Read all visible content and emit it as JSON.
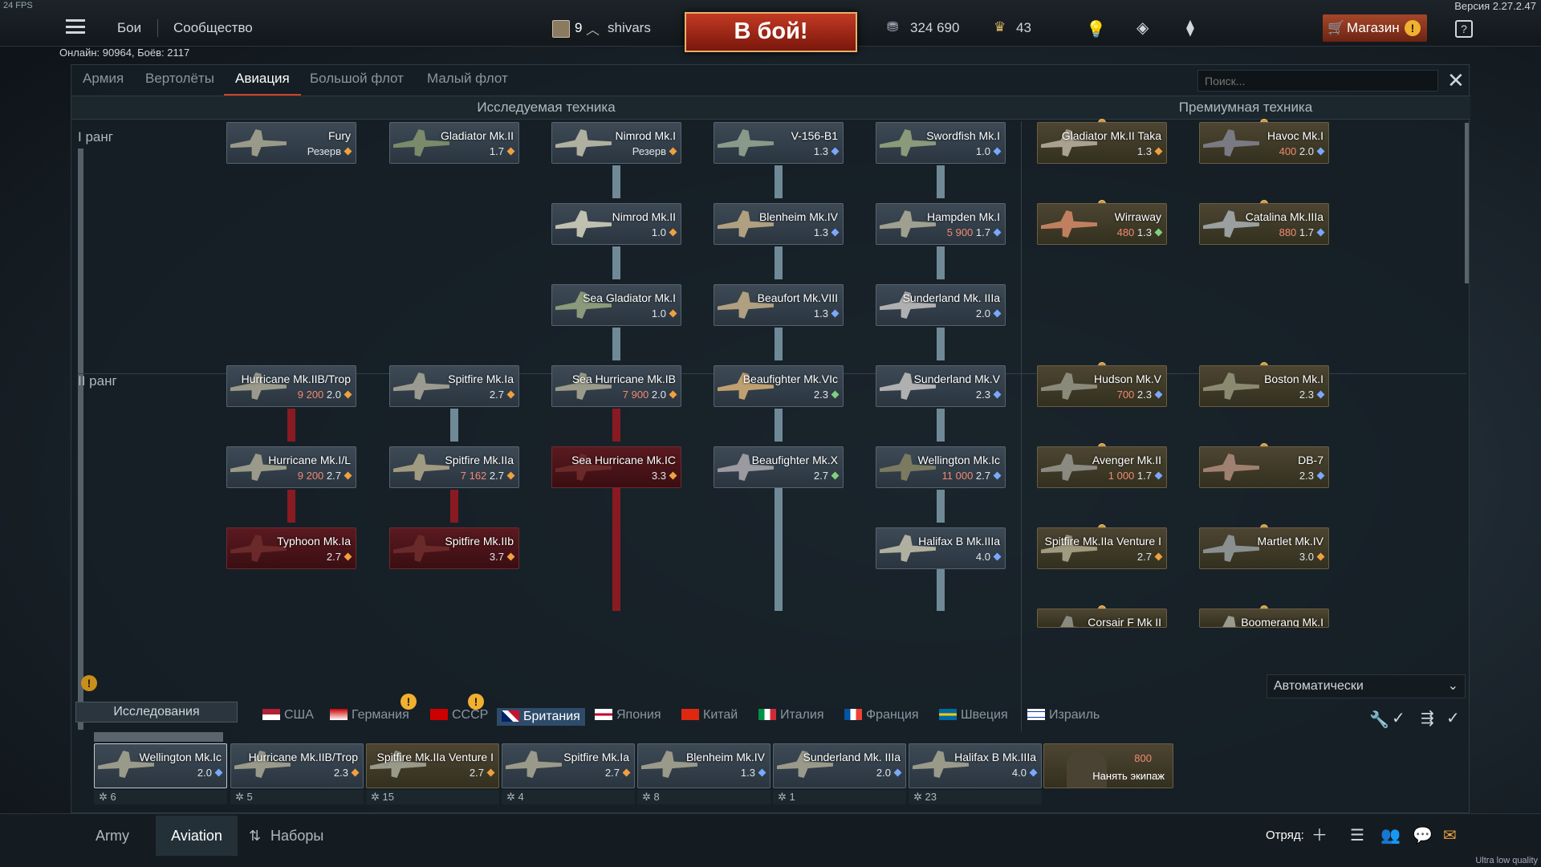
{
  "topbar": {
    "fps": "24 FPS",
    "version": "Версия 2.27.2.47",
    "menu_battles": "Бои",
    "menu_community": "Сообщество",
    "player_level": "9",
    "player_name": "shivars",
    "battle_button": "В бой!",
    "silver": "324 690",
    "gold": "43",
    "shop": "Магазин",
    "online": "Онлайн: 90964, Боёв: 2117"
  },
  "tabs": [
    "Армия",
    "Вертолёты",
    "Авиация",
    "Большой флот",
    "Малый флот"
  ],
  "active_tab": "Авиация",
  "search_placeholder": "Поиск...",
  "headers": {
    "research": "Исследуемая техника",
    "premium": "Премиумная техника"
  },
  "ranks": [
    "I ранг",
    "II ранг"
  ],
  "cards": [
    {
      "name": "Fury",
      "br": "Резерв",
      "diamond": "orange"
    },
    {
      "name": "Gladiator Mk.II",
      "br": "1.7",
      "diamond": "orange"
    },
    {
      "name": "Nimrod Mk.I",
      "br": "Резерв",
      "diamond": "orange"
    },
    {
      "name": "V-156-B1",
      "br": "1.3",
      "diamond": "blue"
    },
    {
      "name": "Swordfish Mk.I",
      "br": "1.0",
      "diamond": "blue"
    },
    {
      "name": "Gladiator Mk.II Taka",
      "br": "1.3",
      "diamond": "orange"
    },
    {
      "name": "Havoc Mk.I",
      "cost": "400",
      "br": "2.0",
      "diamond": "blue"
    },
    {
      "name": "Nimrod Mk.II",
      "br": "1.0",
      "diamond": "orange"
    },
    {
      "name": "Blenheim Mk.IV",
      "br": "1.3",
      "diamond": "blue"
    },
    {
      "name": "Hampden Mk.I",
      "cost": "5 900",
      "br": "1.7",
      "diamond": "blue"
    },
    {
      "name": "Wirraway",
      "cost": "480",
      "br": "1.3",
      "diamond": "green"
    },
    {
      "name": "Catalina Mk.IIIa",
      "cost": "880",
      "br": "1.7",
      "diamond": "blue"
    },
    {
      "name": "Sea Gladiator Mk.I",
      "br": "1.0",
      "diamond": "orange"
    },
    {
      "name": "Beaufort Mk.VIII",
      "br": "1.3",
      "diamond": "blue"
    },
    {
      "name": "Sunderland Mk. IIIa",
      "br": "2.0",
      "diamond": "blue"
    },
    {
      "name": "Hurricane Mk.IIB/Trop",
      "cost": "9 200",
      "br": "2.0",
      "diamond": "orange"
    },
    {
      "name": "Spitfire Mk.Ia",
      "br": "2.7",
      "diamond": "orange"
    },
    {
      "name": "Sea Hurricane Mk.IB",
      "cost": "7 900",
      "br": "2.0",
      "diamond": "orange"
    },
    {
      "name": "Beaufighter Mk.VIc",
      "br": "2.3",
      "diamond": "green"
    },
    {
      "name": "Sunderland Mk.V",
      "br": "2.3",
      "diamond": "blue"
    },
    {
      "name": "Hudson Mk.V",
      "cost": "700",
      "br": "2.3",
      "diamond": "blue"
    },
    {
      "name": "Boston Mk.I",
      "br": "2.3",
      "diamond": "blue"
    },
    {
      "name": "Hurricane Mk.I/L",
      "cost": "9 200",
      "br": "2.7",
      "diamond": "orange"
    },
    {
      "name": "Spitfire Mk.IIa",
      "cost": "7 162",
      "br": "2.7",
      "diamond": "orange"
    },
    {
      "name": "Sea Hurricane Mk.IC",
      "br": "3.3",
      "diamond": "orange"
    },
    {
      "name": "Beaufighter Mk.X",
      "br": "2.7",
      "diamond": "green"
    },
    {
      "name": "Wellington Mk.Ic",
      "cost": "11 000",
      "br": "2.7",
      "diamond": "blue"
    },
    {
      "name": "Avenger Mk.II",
      "cost": "1 000",
      "br": "1.7",
      "diamond": "blue"
    },
    {
      "name": "DB-7",
      "br": "2.3",
      "diamond": "blue"
    },
    {
      "name": "Typhoon Mk.Ia",
      "br": "2.7",
      "diamond": "orange"
    },
    {
      "name": "Spitfire Mk.IIb",
      "br": "3.7",
      "diamond": "orange"
    },
    {
      "name": "Halifax B Mk.IIIa",
      "br": "4.0",
      "diamond": "blue"
    },
    {
      "name": "Spitfire Mk.IIa Venture I",
      "br": "2.7",
      "diamond": "orange"
    },
    {
      "name": "Martlet Mk.IV",
      "br": "3.0",
      "diamond": "orange"
    },
    {
      "name": "Corsair F Mk II",
      "br": ""
    },
    {
      "name": "Boomerang Mk.I",
      "br": ""
    }
  ],
  "research_label": "Исследования",
  "auto_label": "Автоматически",
  "nations": [
    "США",
    "Германия",
    "СССР",
    "Британия",
    "Япония",
    "Китай",
    "Италия",
    "Франция",
    "Швеция",
    "Израиль"
  ],
  "active_nation": "Британия",
  "crew": [
    {
      "name": "Wellington Mk.Ic",
      "br": "2.0",
      "diamond": "blue",
      "slot": "6"
    },
    {
      "name": "Hurricane Mk.IIB/Trop",
      "br": "2.3",
      "diamond": "orange",
      "slot": "5"
    },
    {
      "name": "Spitfire Mk.IIa Venture I",
      "br": "2.7",
      "diamond": "orange",
      "slot": "15"
    },
    {
      "name": "Spitfire Mk.Ia",
      "br": "2.7",
      "diamond": "orange",
      "slot": "4"
    },
    {
      "name": "Blenheim Mk.IV",
      "br": "1.3",
      "diamond": "blue",
      "slot": "8"
    },
    {
      "name": "Sunderland Mk. IIIa",
      "br": "2.0",
      "diamond": "blue",
      "slot": "1"
    },
    {
      "name": "Halifax B Mk.IIIa",
      "br": "4.0",
      "diamond": "blue",
      "slot": "23"
    }
  ],
  "hire_crew": {
    "cost": "800",
    "label": "Нанять экипаж"
  },
  "bottombar": {
    "army": "Army",
    "aviation": "Aviation",
    "sets": "Наборы",
    "squad": "Отряд:",
    "quality": "Ultra low quality"
  }
}
